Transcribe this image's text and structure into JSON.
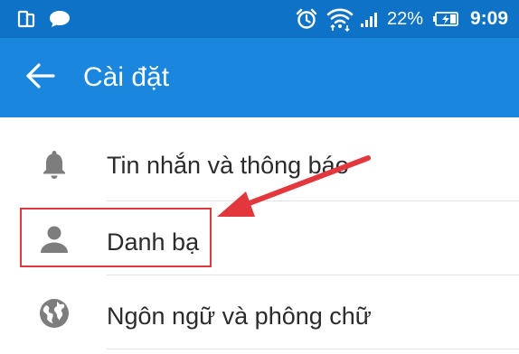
{
  "status_bar": {
    "battery_percent": "22%",
    "time": "9:09",
    "icons": [
      "sim-card-icon",
      "chat-bubble-icon",
      "alarm-icon",
      "wifi-icon",
      "signal-icon",
      "battery-charging-icon"
    ]
  },
  "app_bar": {
    "title": "Cài đặt",
    "back_icon": "arrow-back-icon"
  },
  "settings": {
    "items": [
      {
        "label": "Tin nhắn và thông báo",
        "icon": "bell-icon"
      },
      {
        "label": "Danh bạ",
        "icon": "person-icon"
      },
      {
        "label": "Ngôn ngữ và phông chữ",
        "icon": "globe-icon"
      }
    ]
  },
  "colors": {
    "status_bar": "#0e72c6",
    "app_bar": "#1a86de",
    "annotation": "#e2373c"
  }
}
